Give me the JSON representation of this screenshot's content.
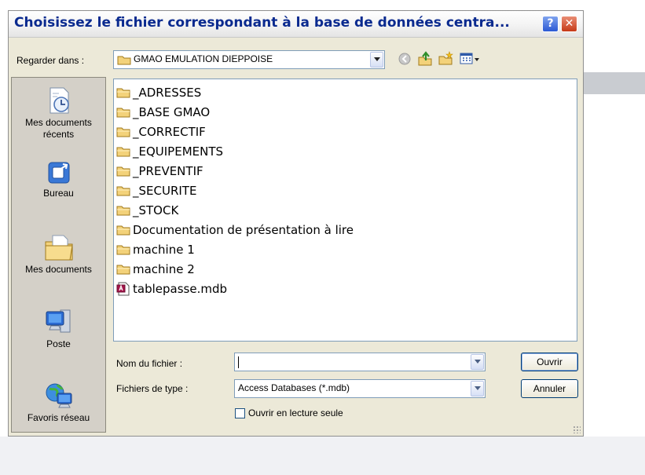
{
  "dialog": {
    "title": "Choisissez le fichier correspondant à la base de données centra...",
    "help_button": "?",
    "close_button": "✕"
  },
  "look_in": {
    "label": "Regarder dans :",
    "value": "GMAO EMULATION DIEPPOISE"
  },
  "places": [
    {
      "label": "Mes documents récents",
      "icon": "recent-documents-icon"
    },
    {
      "label": "Bureau",
      "icon": "desktop-icon"
    },
    {
      "label": "Mes documents",
      "icon": "my-documents-icon"
    },
    {
      "label": "Poste",
      "icon": "computer-icon"
    },
    {
      "label": "Favoris réseau",
      "icon": "network-icon"
    }
  ],
  "files": [
    {
      "name": "_ADRESSES",
      "type": "folder"
    },
    {
      "name": "_BASE GMAO",
      "type": "folder"
    },
    {
      "name": "_CORRECTIF",
      "type": "folder"
    },
    {
      "name": "_EQUIPEMENTS",
      "type": "folder"
    },
    {
      "name": "_PREVENTIF",
      "type": "folder"
    },
    {
      "name": "_SECURITE",
      "type": "folder"
    },
    {
      "name": "_STOCK",
      "type": "folder"
    },
    {
      "name": "Documentation de présentation à lire",
      "type": "folder"
    },
    {
      "name": "machine 1",
      "type": "folder"
    },
    {
      "name": "machine 2",
      "type": "folder"
    },
    {
      "name": "tablepasse.mdb",
      "type": "access-db"
    }
  ],
  "filename": {
    "label": "Nom du fichier :",
    "value": ""
  },
  "filetype": {
    "label": "Fichiers de type :",
    "value": "Access Databases (*.mdb)"
  },
  "readonly": {
    "label": "Ouvrir en lecture seule",
    "checked": false
  },
  "buttons": {
    "open": "Ouvrir",
    "cancel": "Annuler"
  },
  "colors": {
    "title_text": "#0a2a8f",
    "dialog_bg": "#ece9d8",
    "close_button": "#c63a18"
  }
}
